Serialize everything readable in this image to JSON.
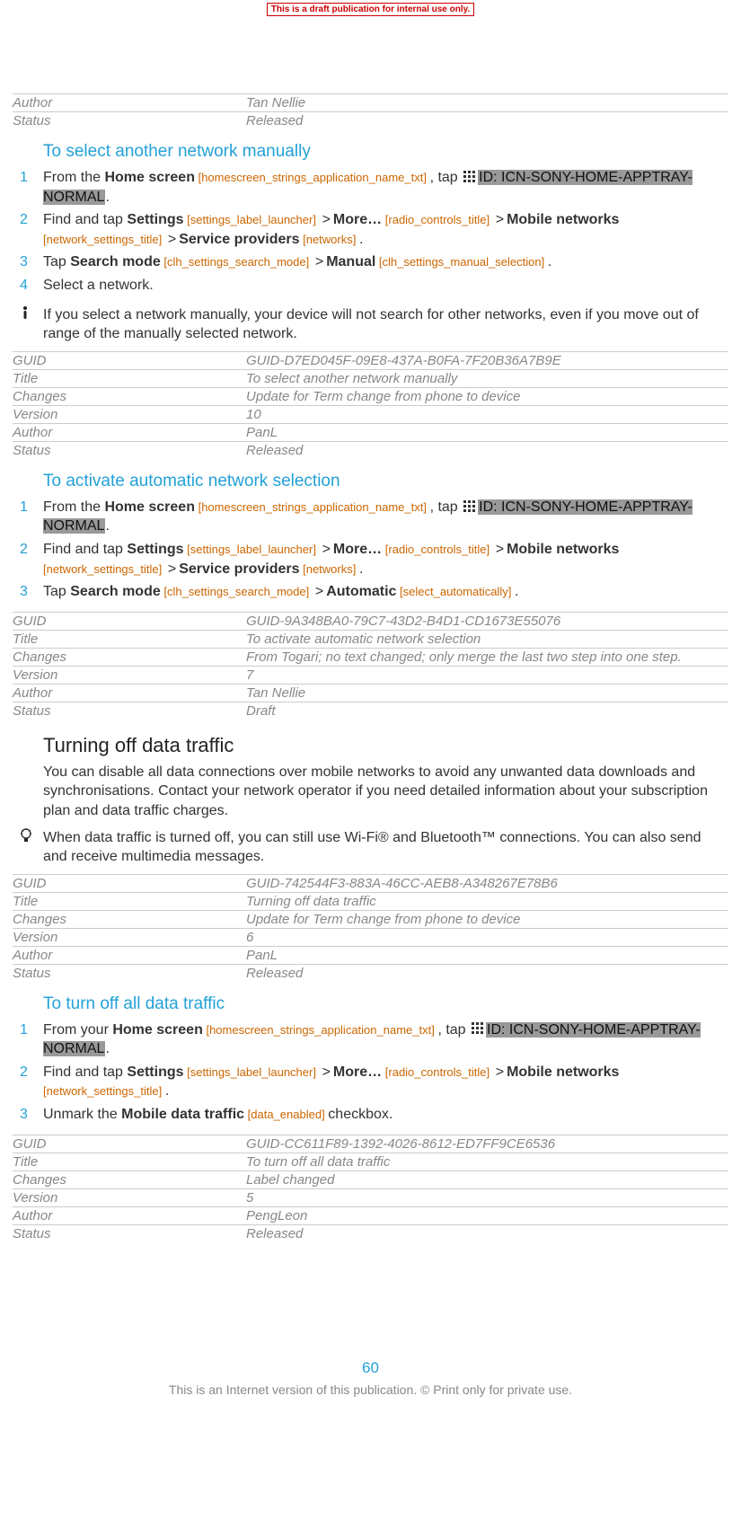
{
  "banner": "This is a draft publication for internal use only.",
  "top_meta": {
    "rows": [
      {
        "k": "Author",
        "v": "Tan Nellie"
      },
      {
        "k": "Status",
        "v": "Released"
      }
    ]
  },
  "sec1": {
    "title": "To select another network manually",
    "steps": {
      "s1": {
        "num": "1",
        "t1": "From the ",
        "b1": "Home screen",
        "ref1": " [homescreen_strings_application_name_txt] ",
        "t2": ", tap ",
        "hl": "ID: ICN-SONY-HOME-APPTRAY-NORMAL",
        "dot": "."
      },
      "s2": {
        "num": "2",
        "t1": "Find and tap ",
        "b1": "Settings",
        "ref1": " [settings_label_launcher] ",
        "b2": "More…",
        "ref2": " [radio_controls_title] ",
        "b3": "Mobile networks",
        "ref3": " [network_settings_title] ",
        "b4": "Service providers",
        "ref4": " [networks] ",
        "dot": "."
      },
      "s3": {
        "num": "3",
        "t1": "Tap ",
        "b1": "Search mode",
        "ref1": " [clh_settings_search_mode] ",
        "b2": "Manual",
        "ref2": " [clh_settings_manual_selection] ",
        "dot": "."
      },
      "s4": {
        "num": "4",
        "t1": "Select a network."
      }
    },
    "note": "If you select a network manually, your device will not search for other networks, even if you move out of range of the manually selected network.",
    "meta": {
      "rows": [
        {
          "k": "GUID",
          "v": "GUID-D7ED045F-09E8-437A-B0FA-7F20B36A7B9E"
        },
        {
          "k": "Title",
          "v": "To select another network manually"
        },
        {
          "k": "Changes",
          "v": "Update for Term change from phone to device"
        },
        {
          "k": "Version",
          "v": "10"
        },
        {
          "k": "Author",
          "v": "PanL"
        },
        {
          "k": "Status",
          "v": "Released"
        }
      ]
    }
  },
  "sec2": {
    "title": "To activate automatic network selection",
    "steps": {
      "s1": {
        "num": "1",
        "t1": "From the ",
        "b1": "Home screen",
        "ref1": " [homescreen_strings_application_name_txt] ",
        "t2": ", tap ",
        "hl": "ID: ICN-SONY-HOME-APPTRAY-NORMAL",
        "dot": "."
      },
      "s2": {
        "num": "2",
        "t1": "Find and tap ",
        "b1": "Settings",
        "ref1": " [settings_label_launcher] ",
        "b2": "More…",
        "ref2": " [radio_controls_title] ",
        "b3": "Mobile networks",
        "ref3": " [network_settings_title] ",
        "b4": "Service providers",
        "ref4": " [networks] ",
        "dot": "."
      },
      "s3": {
        "num": "3",
        "t1": "Tap ",
        "b1": "Search mode",
        "ref1": " [clh_settings_search_mode] ",
        "b2": "Automatic",
        "ref2": " [select_automatically] ",
        "dot": "."
      }
    },
    "meta": {
      "rows": [
        {
          "k": "GUID",
          "v": "GUID-9A348BA0-79C7-43D2-B4D1-CD1673E55076"
        },
        {
          "k": "Title",
          "v": "To activate automatic network selection"
        },
        {
          "k": "Changes",
          "v": "From Togari; no text changed; only merge the last two step into one step."
        },
        {
          "k": "Version",
          "v": "7"
        },
        {
          "k": "Author",
          "v": "Tan Nellie"
        },
        {
          "k": "Status",
          "v": "Draft"
        }
      ]
    }
  },
  "sec3": {
    "title": "Turning off data traffic",
    "para": "You can disable all data connections over mobile networks to avoid any unwanted data downloads and synchronisations. Contact your network operator if you need detailed information about your subscription plan and data traffic charges.",
    "tip": "When data traffic is turned off, you can still use Wi-Fi® and Bluetooth™ connections. You can also send and receive multimedia messages.",
    "meta": {
      "rows": [
        {
          "k": "GUID",
          "v": "GUID-742544F3-883A-46CC-AEB8-A348267E78B6"
        },
        {
          "k": "Title",
          "v": "Turning off data traffic"
        },
        {
          "k": "Changes",
          "v": "Update for Term change from phone to device"
        },
        {
          "k": "Version",
          "v": "6"
        },
        {
          "k": "Author",
          "v": "PanL"
        },
        {
          "k": "Status",
          "v": "Released"
        }
      ]
    }
  },
  "sec4": {
    "title": "To turn off all data traffic",
    "steps": {
      "s1": {
        "num": "1",
        "t1": "From your ",
        "b1": "Home screen",
        "ref1": " [homescreen_strings_application_name_txt] ",
        "t2": ", tap ",
        "hl": "ID: ICN-SONY-HOME-APPTRAY-NORMAL",
        "dot": "."
      },
      "s2": {
        "num": "2",
        "t1": "Find and tap ",
        "b1": "Settings",
        "ref1": " [settings_label_launcher] ",
        "b2": "More…",
        "ref2": " [radio_controls_title] ",
        "b3": "Mobile networks",
        "ref3": " [network_settings_title] ",
        "dot": "."
      },
      "s3": {
        "num": "3",
        "t1": "Unmark the ",
        "b1": "Mobile data traffic",
        "ref1": " [data_enabled] ",
        "t2": "checkbox."
      }
    },
    "meta": {
      "rows": [
        {
          "k": "GUID",
          "v": "GUID-CC611F89-1392-4026-8612-ED7FF9CE6536"
        },
        {
          "k": "Title",
          "v": "To turn off all data traffic"
        },
        {
          "k": "Changes",
          "v": "Label changed"
        },
        {
          "k": "Version",
          "v": "5"
        },
        {
          "k": "Author",
          "v": "PengLeon"
        },
        {
          "k": "Status",
          "v": "Released"
        }
      ]
    }
  },
  "gt": ">",
  "page_number": "60",
  "footer": "This is an Internet version of this publication. © Print only for private use."
}
